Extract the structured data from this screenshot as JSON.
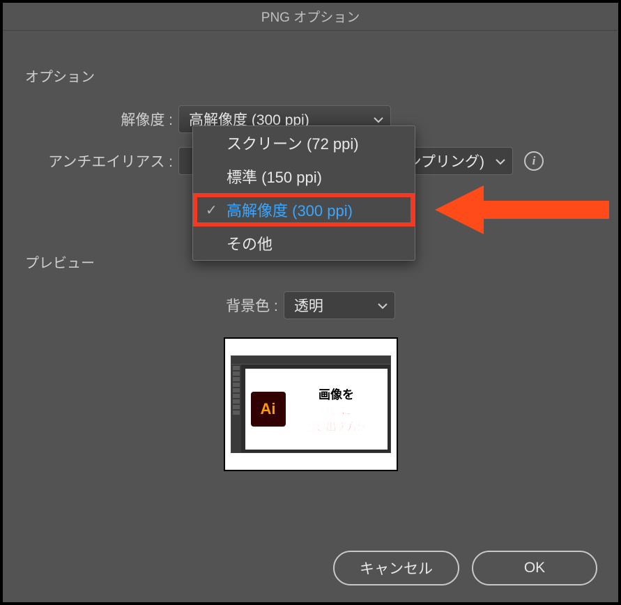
{
  "dialog": {
    "title": "PNG オプション"
  },
  "options": {
    "section_title": "オプション",
    "resolution": {
      "label": "解像度 :",
      "selected": "高解像度 (300 ppi)",
      "items": [
        "スクリーン (72 ppi)",
        "標準 (150 ppi)",
        "高解像度 (300 ppi)",
        "その他"
      ],
      "selected_index": 2
    },
    "antialias": {
      "label": "アンチエイリアス :",
      "visible_text": "ンプリング)"
    }
  },
  "preview": {
    "section_title": "プレビュー",
    "bg_label": "背景色 :",
    "bg_selected": "透明",
    "thumb": {
      "ai": "Ai",
      "t1": "画像を",
      "t2": "綺麗に",
      "t3": "書き出す方法"
    }
  },
  "buttons": {
    "cancel": "キャンセル",
    "ok": "OK"
  },
  "colors": {
    "highlight_border": "#f03a24",
    "highlight_text": "#3aa6ff",
    "arrow": "#ff4a1a"
  }
}
